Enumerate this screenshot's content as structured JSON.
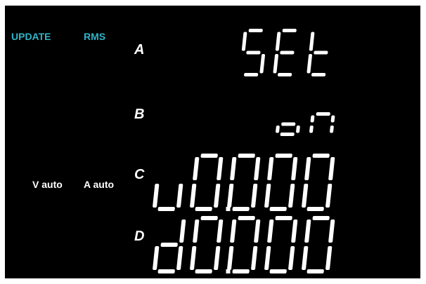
{
  "indicators": {
    "update": "UPDATE",
    "rms": "RMS",
    "v_range": "V auto",
    "a_range": "A auto"
  },
  "rows": [
    {
      "id": "A",
      "label": "A",
      "display": "SEt"
    },
    {
      "id": "B",
      "label": "B",
      "display": "on"
    },
    {
      "id": "C",
      "label": "C",
      "display": "u0.000"
    },
    {
      "id": "D",
      "label": "D",
      "display": "d0.000"
    }
  ],
  "colors": {
    "background": "#000000",
    "indicator_accent": "#2fb4c8",
    "segment": "#ffffff"
  }
}
